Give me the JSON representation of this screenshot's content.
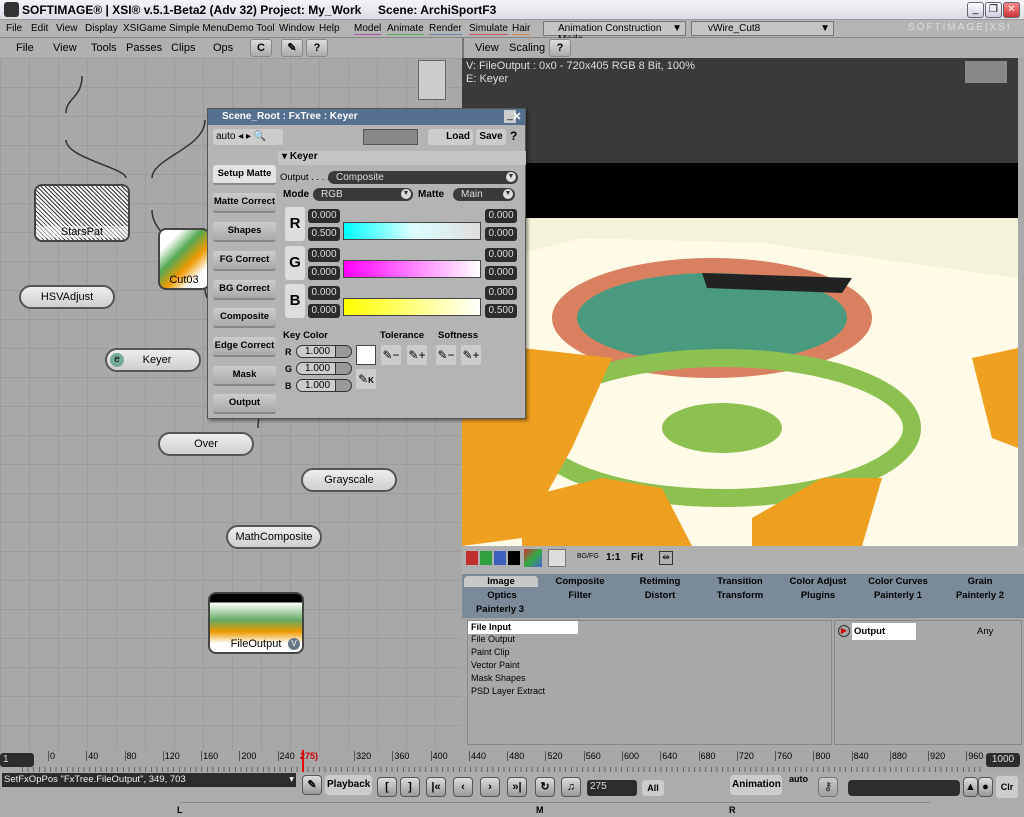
{
  "window": {
    "title": "SOFTIMAGE® | XSI® v.5.1-Beta2 (Adv 32) Project: My_Work     Scene: ArchiSportF3",
    "minimize": "_",
    "restore": "❐",
    "close": "✕"
  },
  "menubar": {
    "items": [
      "File",
      "Edit",
      "View",
      "Display",
      "XSIGame",
      "Simple Menu",
      "Demo Tool",
      "Window",
      "Help"
    ],
    "modules": [
      "Model",
      "Animate",
      "Render",
      "Simulate",
      "Hair"
    ],
    "mode": "Animation Construction Mode",
    "object": "vWire_Cut8",
    "brand": "SOFTIMAGE|XSI"
  },
  "fxtree_toolbar": {
    "items": [
      "File",
      "View",
      "Tools",
      "Passes",
      "Clips",
      "Ops"
    ],
    "help": "?"
  },
  "viewer_toolbar": {
    "items": [
      "View",
      "Scaling"
    ],
    "help": "?"
  },
  "viewer": {
    "info_line1": "V: FileOutput : 0x0 - 720x405 RGB 8 Bit, 100%",
    "info_line2": "E: Keyer"
  },
  "nodes": {
    "starspat": "StarsPat",
    "cut03": "Cut03",
    "hsvadjust": "HSVAdjust",
    "keyer": "Keyer",
    "keyer_badge": "e",
    "over": "Over",
    "grayscale": "Grayscale",
    "mathcomposite": "MathComposite",
    "fileoutput": "FileOutput",
    "fileoutput_badge": "V"
  },
  "keyer_dialog": {
    "title": "Scene_Root : FxTree : Keyer",
    "auto": "auto",
    "load": "Load",
    "save": "Save",
    "help": "?",
    "section": "Keyer",
    "side_buttons": [
      "Setup Matte",
      "Matte Correct",
      "Shapes",
      "FG Correct",
      "BG Correct",
      "Composite",
      "Edge Correct",
      "Mask",
      "Output"
    ],
    "output_label": "Output . . . .",
    "output_value": "Composite",
    "mode_label": "Mode",
    "mode_value": "RGB",
    "matte_label": "Matte",
    "matte_value": "Main",
    "channels": [
      {
        "name": "R",
        "left": [
          "0.000",
          "0.500"
        ],
        "right": [
          "0.000",
          "0.000"
        ],
        "color": "#00ffff"
      },
      {
        "name": "G",
        "left": [
          "0.000",
          "0.000"
        ],
        "right": [
          "0.000",
          "0.000"
        ],
        "color": "#ff00ff"
      },
      {
        "name": "B",
        "left": [
          "0.000",
          "0.000"
        ],
        "right": [
          "0.000",
          "0.500"
        ],
        "color": "#ffff00"
      }
    ],
    "key_color_label": "Key Color",
    "key_color": {
      "R": "1.000",
      "G": "1.000",
      "B": "1.000"
    },
    "tolerance_label": "Tolerance",
    "softness_label": "Softness",
    "pick_key": "K"
  },
  "viewer_tools": {
    "bgfg": "BG/FG",
    "one_to_one": "1:1",
    "fit": "Fit",
    "swatches": [
      "#c03030",
      "#30a040",
      "#4060c0",
      "#000000"
    ]
  },
  "tabs": {
    "row1": [
      "Image",
      "Composite",
      "Retiming",
      "Transition",
      "Color Adjust",
      "Color Curves",
      "Grain"
    ],
    "row2": [
      "Optics",
      "Filter",
      "Distort",
      "Transform",
      "Plugins",
      "Painterly 1",
      "Painterly 2"
    ],
    "row3": [
      "Painterly 3"
    ],
    "active": "Image"
  },
  "op_list": [
    "File Input",
    "File Output",
    "Paint Clip",
    "Vector Paint",
    "Mask Shapes",
    "PSD Layer Extract"
  ],
  "ports": {
    "name": "Output",
    "type": "Any"
  },
  "timeline": {
    "start": "1",
    "end": "1000",
    "current": "275",
    "current_marker": "275)",
    "ticks": [
      "0",
      "40",
      "80",
      "120",
      "160",
      "200",
      "240",
      "320",
      "360",
      "400",
      "440",
      "480",
      "520",
      "560",
      "600",
      "640",
      "680",
      "720",
      "760",
      "800",
      "840",
      "880",
      "920",
      "960"
    ]
  },
  "command": {
    "text": "SetFxOpPos \"FxTree.FileOutput\", 349, 703",
    "playback": "Playback",
    "frame": "275",
    "all": "All",
    "animation": "Animation",
    "auto": "auto",
    "clr": "Clr",
    "markers": [
      "L",
      "M",
      "R"
    ]
  }
}
